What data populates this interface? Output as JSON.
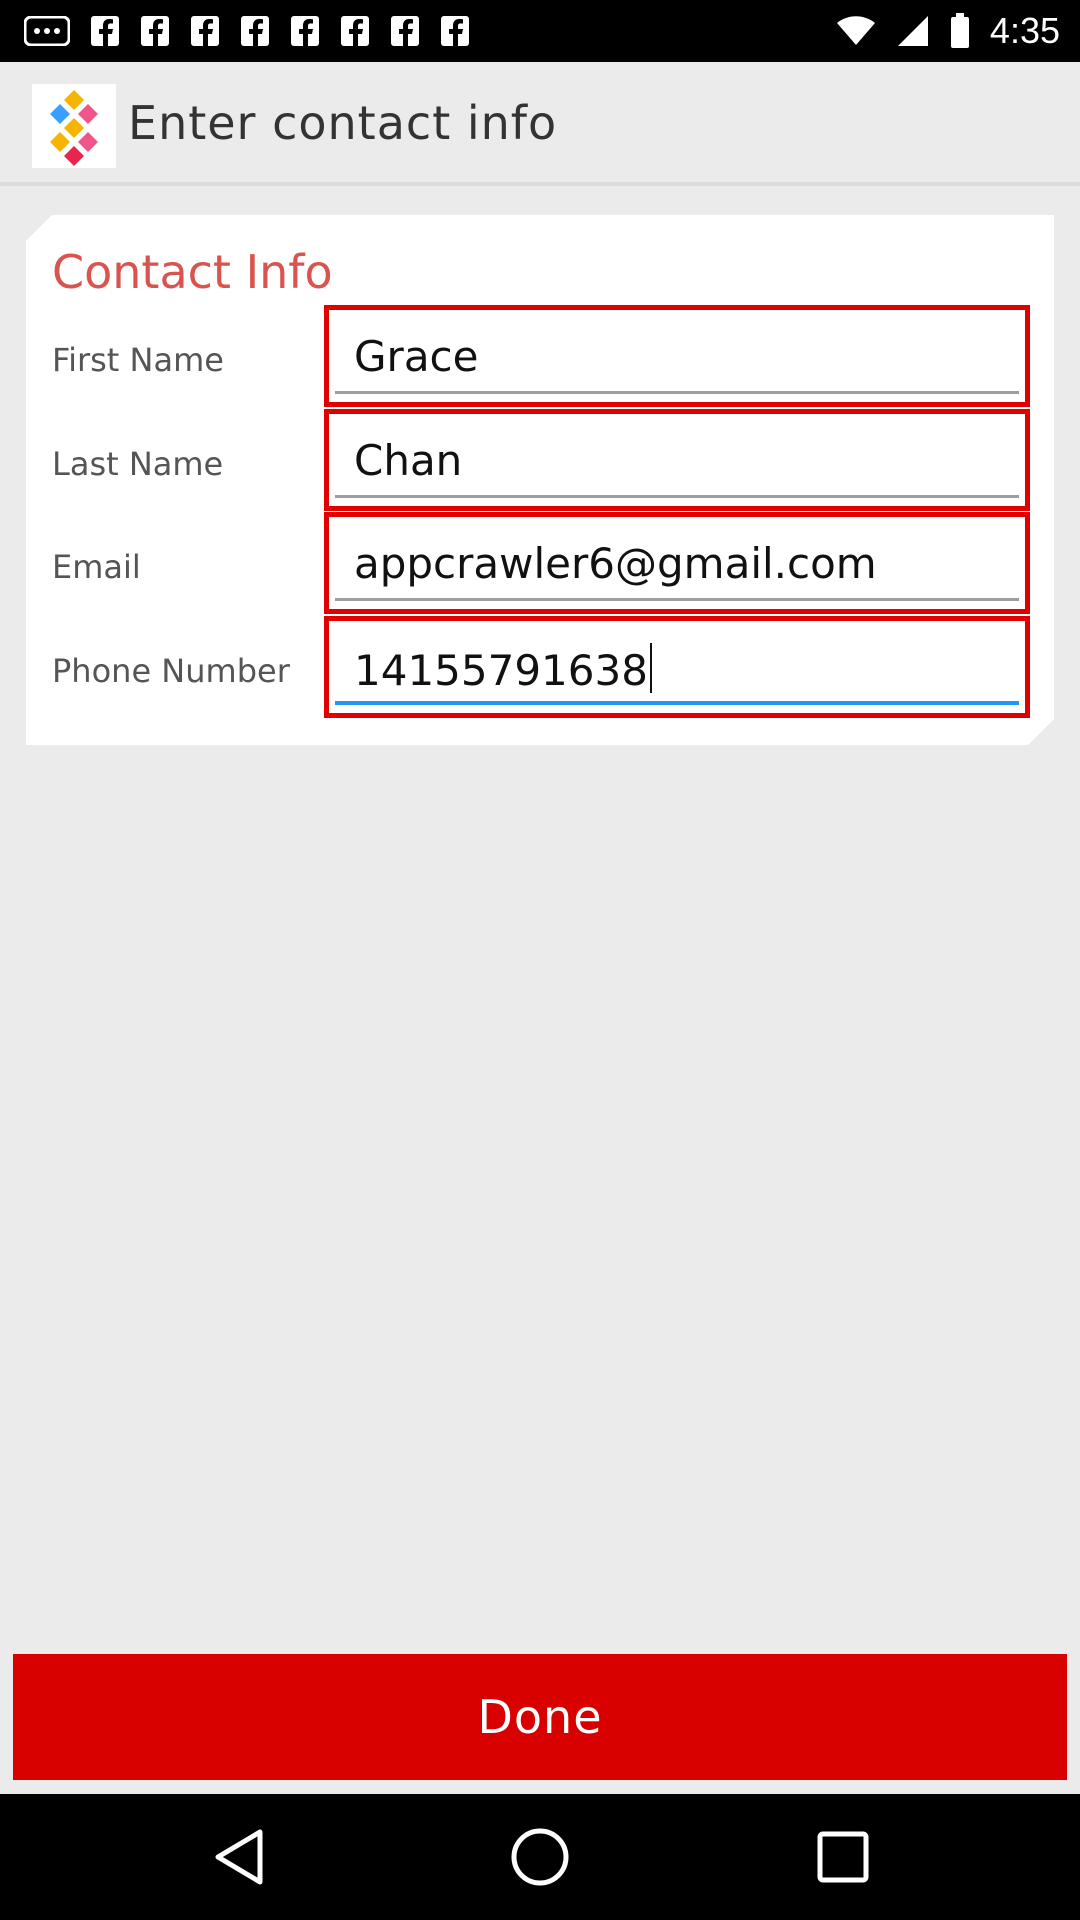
{
  "status_bar": {
    "time": "4:35",
    "left_icons": [
      "more-icon",
      "facebook-icon",
      "facebook-icon",
      "facebook-icon",
      "facebook-icon",
      "facebook-icon",
      "facebook-icon",
      "facebook-icon"
    ],
    "right_icons": [
      "wifi-icon",
      "signal-icon",
      "battery-icon"
    ]
  },
  "app_bar": {
    "title": "Enter contact info"
  },
  "form": {
    "heading": "Contact Info",
    "fields": [
      {
        "label": "First Name",
        "value": "Grace"
      },
      {
        "label": "Last Name",
        "value": "Chan"
      },
      {
        "label": "Email",
        "value": "appcrawler6@gmail.com"
      },
      {
        "label": "Phone Number",
        "value": "14155791638"
      }
    ]
  },
  "done_label": "Done",
  "colors": {
    "accent": "#d90000",
    "heading": "#d9534f",
    "focus_underline": "#2196f3"
  },
  "nav_bar": [
    "back-icon",
    "home-icon",
    "recents-icon"
  ]
}
